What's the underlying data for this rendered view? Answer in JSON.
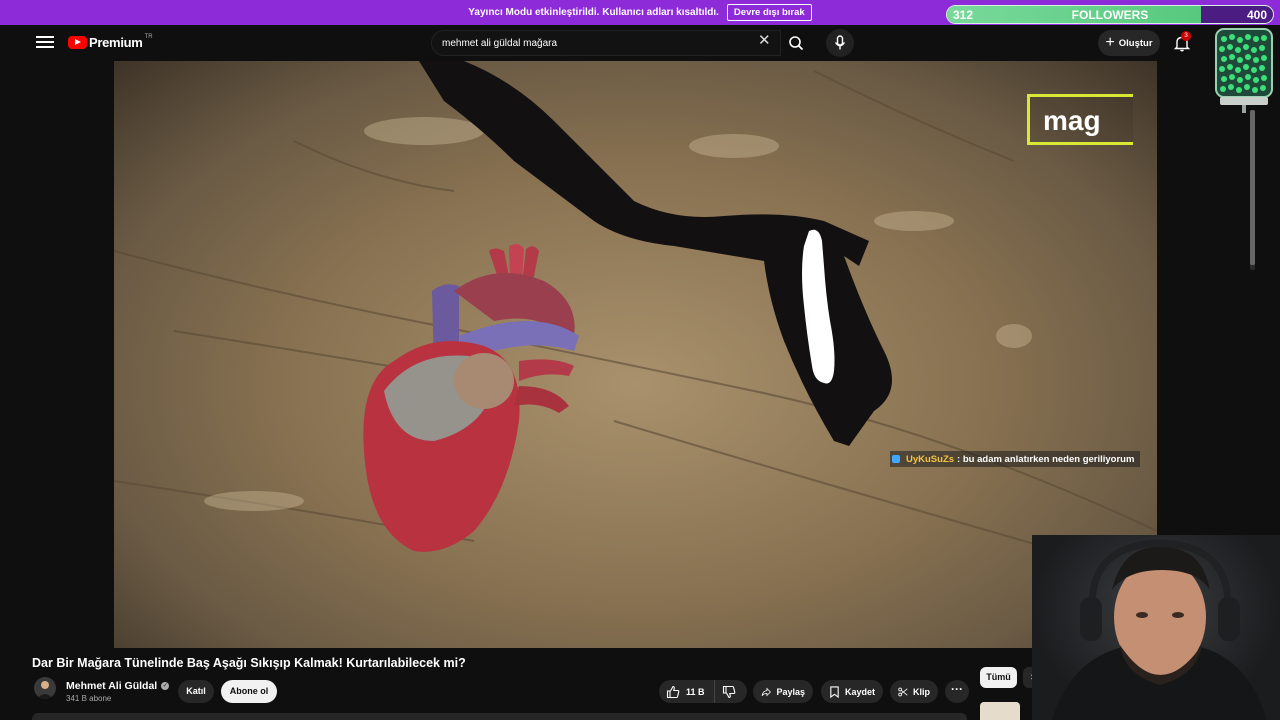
{
  "stream_bar": {
    "message": "Yayıncı Modu etkinleştirildi. Kullanıcı adları kısaltıldı.",
    "disable_label": "Devre dışı bırak"
  },
  "followers_widget": {
    "current": "312",
    "label": "FOLLOWERS",
    "goal": "400",
    "progress_fraction": 0.78
  },
  "header": {
    "logo_text": "Premium",
    "logo_region": "TR",
    "search_value": "mehmet ali güldal mağara",
    "create_label": "Oluştur",
    "notification_count": "3"
  },
  "video": {
    "overlay_text": "mag",
    "chat": {
      "user": "UyKuSuZs",
      "separator": ":",
      "text": "bu adam anlatırken neden geriliyorum"
    }
  },
  "meta": {
    "title": "Dar Bir Mağara Tünelinde Baş Aşağı Sıkışıp Kalmak! Kurtarılabilecek mi?",
    "channel_name": "Mehmet Ali Güldal",
    "subscribers": "341 B abone",
    "join_label": "Katıl",
    "subscribe_label": "Abone ol",
    "likes": "11 B",
    "share_label": "Paylaş",
    "save_label": "Kaydet",
    "clip_label": "Klip",
    "more_label": "···"
  },
  "sidebar_chips": {
    "all_label": "Tümü",
    "next_label": "Si"
  },
  "icons": {
    "menu": "hamburger-menu-icon",
    "youtube": "youtube-logo-icon",
    "search": "search-icon",
    "clear": "close-icon",
    "mic": "microphone-icon",
    "create": "plus-icon",
    "bell": "bell-icon",
    "like": "thumbs-up-icon",
    "dislike": "thumbs-down-icon",
    "share": "share-arrow-icon",
    "save": "bookmark-icon",
    "clip": "scissors-icon",
    "verified": "verified-check-icon",
    "chat_badge": "chat-badge-icon"
  },
  "colors": {
    "stream_bar": "#8e2bd8",
    "followers_fill": "#57c97e",
    "overlay_border": "#d8e834",
    "chat_username": "#f4c542",
    "youtube_red": "#ff0000"
  }
}
